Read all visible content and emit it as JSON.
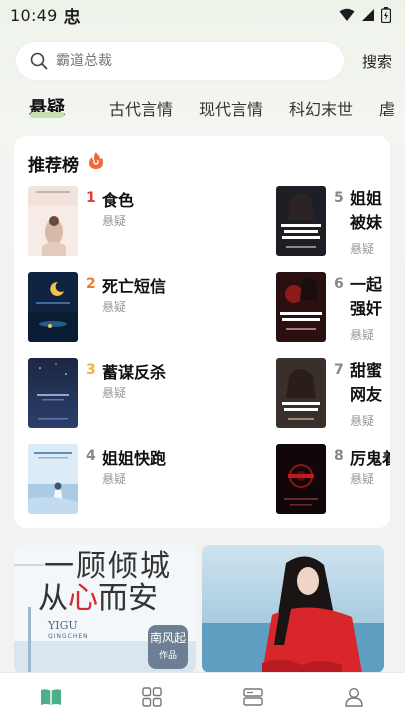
{
  "status_bar": {
    "time": "10:49",
    "app_glyph": "忠"
  },
  "search": {
    "placeholder": "霸道总裁",
    "button_label": "搜索"
  },
  "tabs": [
    {
      "label": "悬疑",
      "active": true
    },
    {
      "label": "古代言情",
      "active": false
    },
    {
      "label": "现代言情",
      "active": false
    },
    {
      "label": "科幻末世",
      "active": false
    },
    {
      "label": "虐",
      "active": false
    }
  ],
  "ranking": {
    "title": "推荐榜",
    "books": [
      {
        "rank": "1",
        "title": "食色",
        "genre": "悬疑",
        "rank_color": "#e23b3b"
      },
      {
        "rank": "2",
        "title": "死亡短信",
        "genre": "悬疑",
        "rank_color": "#f07a2a"
      },
      {
        "rank": "3",
        "title": "蓄谋反杀",
        "genre": "悬疑",
        "rank_color": "#f3b33a"
      },
      {
        "rank": "4",
        "title": "姐姐快跑",
        "genre": "悬疑",
        "rank_color": "#888888"
      },
      {
        "rank": "5",
        "title": "姐姐被妹妹冒充",
        "genre": "悬疑",
        "rank_color": "#888888"
      },
      {
        "rank": "6",
        "title": "一起强奸案，隐",
        "genre": "悬疑",
        "rank_color": "#888888"
      },
      {
        "rank": "7",
        "title": "甜蜜网友为死亡",
        "genre": "悬疑",
        "rank_color": "#888888"
      },
      {
        "rank": "8",
        "title": "厉鬼着",
        "genre": "悬疑",
        "rank_color": "#888888"
      }
    ]
  },
  "banners": [
    {
      "line1": "一顾倾城",
      "line2_a": "从",
      "line2_b": "心",
      "line2_c": "而安",
      "small1": "YIGU",
      "small2": "QINGCHEN",
      "author": "南风起",
      "author_sub": "作品"
    },
    {
      "name": "red-dress-woman-cover"
    }
  ],
  "bottom_nav": [
    {
      "name": "bookshelf",
      "icon": "open-book-icon",
      "active": true
    },
    {
      "name": "category",
      "icon": "grid-icon",
      "active": false
    },
    {
      "name": "library",
      "icon": "stack-icon",
      "active": false
    },
    {
      "name": "profile",
      "icon": "person-icon",
      "active": false
    }
  ],
  "colors": {
    "accent_green": "#4caf8a",
    "tab_underline": "#c7dfb3",
    "hot_orange": "#f06a3c"
  }
}
